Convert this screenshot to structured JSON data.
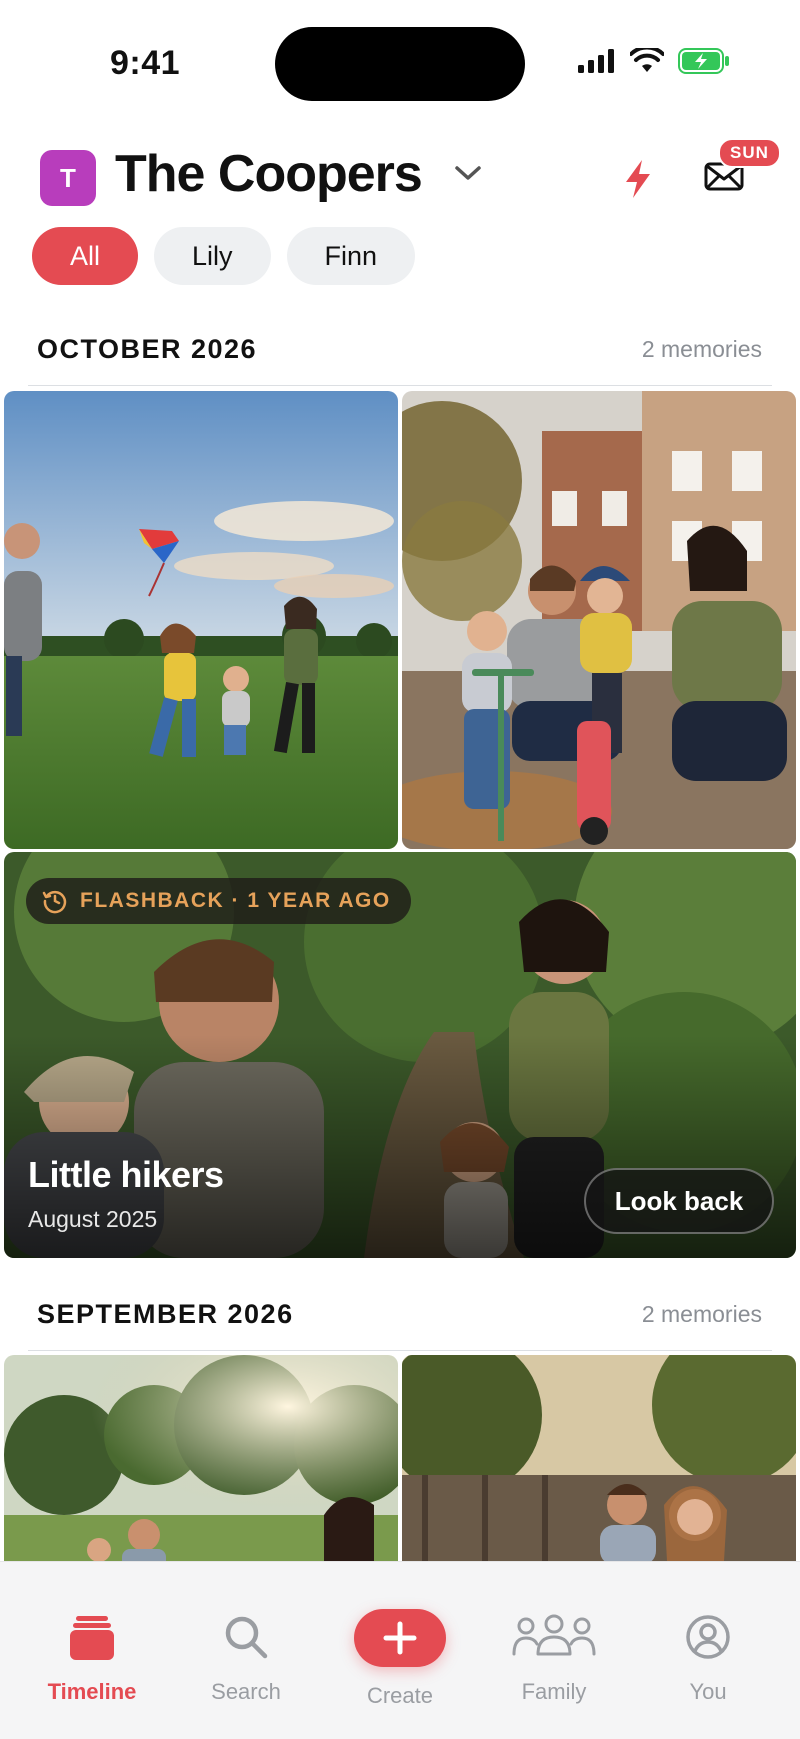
{
  "status_bar": {
    "time": "9:41"
  },
  "header": {
    "avatar_initial": "T",
    "family_name": "The Coopers",
    "mail_badge": "SUN",
    "icons": [
      "chevron-down-icon",
      "bolt-icon",
      "envelope-icon"
    ]
  },
  "filters": [
    {
      "label": "All",
      "active": true
    },
    {
      "label": "Lily",
      "active": false
    },
    {
      "label": "Finn",
      "active": false
    }
  ],
  "sections": [
    {
      "title": "OCTOBER 2026",
      "count": "2 memories",
      "photos": [
        "Family running with kite in field",
        "Parents helping kids with scooter and balance bike"
      ]
    },
    {
      "title": "SEPTEMBER 2026",
      "count": "2 memories",
      "photos": [
        "Family in sunny park",
        "Family laughing in garden"
      ]
    }
  ],
  "flashback": {
    "badge": "FLASHBACK · 1 YEAR AGO",
    "title": "Little hikers",
    "subtitle": "August 2025",
    "button": "Look back"
  },
  "tab_bar": {
    "tabs": [
      {
        "label": "Timeline",
        "icon": "timeline-icon",
        "active": true
      },
      {
        "label": "Search",
        "icon": "search-icon",
        "active": false
      },
      {
        "label": "Create",
        "icon": "plus-icon",
        "active": false
      },
      {
        "label": "Family",
        "icon": "family-icon",
        "active": false
      },
      {
        "label": "You",
        "icon": "profile-icon",
        "active": false
      }
    ]
  },
  "colors": {
    "accent": "#e44b52",
    "avatar": "#b83dbc",
    "flashback_text": "#e6a25a"
  }
}
